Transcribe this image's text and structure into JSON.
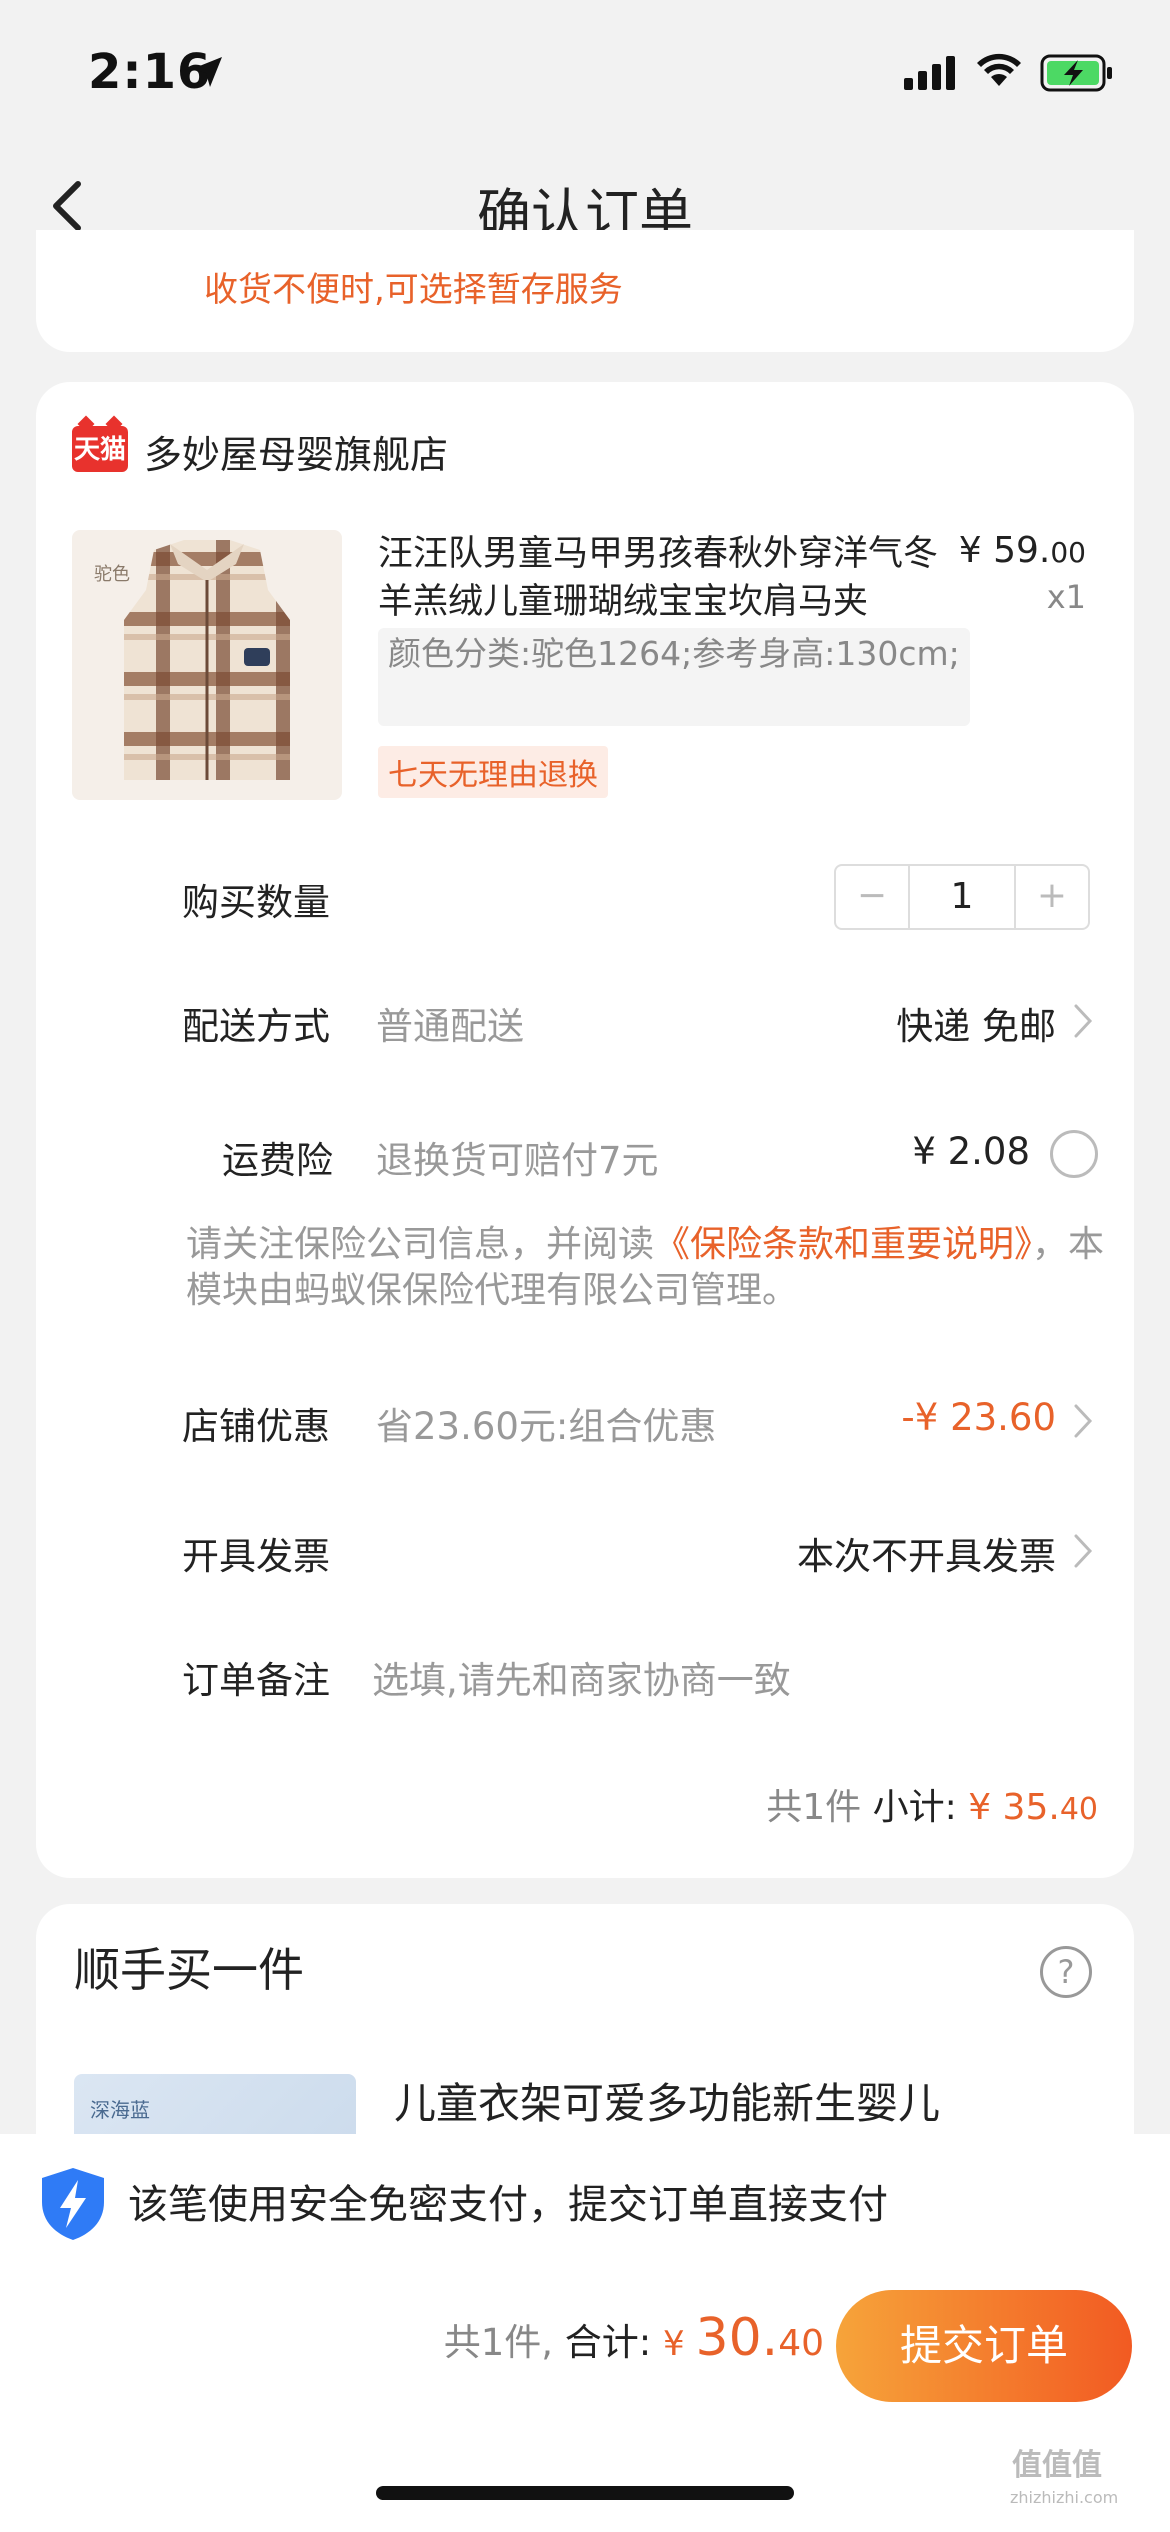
{
  "status_bar": {
    "time": "2:16"
  },
  "nav": {
    "title": "确认订单"
  },
  "temp_service": {
    "text": "收货不便时,可选择暂存服务"
  },
  "shop": {
    "badge": "天猫",
    "name": "多妙屋母婴旗舰店"
  },
  "product": {
    "img_label": "驼色",
    "title": "汪汪队男童马甲男孩春秋外穿洋气冬羊羔绒儿童珊瑚绒宝宝坎肩马夹",
    "price_int": "¥ 59.",
    "price_dec": "00",
    "qty": "x1",
    "sku": "颜色分类:驼色1264;参考身高:130cm;",
    "return_tag": "七天无理由退换"
  },
  "quantity": {
    "label": "购买数量",
    "minus": "−",
    "value": "1",
    "plus": "+"
  },
  "delivery": {
    "label": "配送方式",
    "method": "普通配送",
    "value": "快递 免邮"
  },
  "insurance": {
    "label": "运费险",
    "desc": "退换货可赔付7元",
    "price": "¥ 2.08"
  },
  "notice": {
    "prefix": "请关注保险公司信息，并阅读",
    "link": "《保险条款和重要说明》",
    "suffix": "，本模块由蚂蚁保保险代理有限公司管理。"
  },
  "discount": {
    "label": "店铺优惠",
    "desc": "省23.60元:组合优惠",
    "value": "-¥ 23.60"
  },
  "invoice": {
    "label": "开具发票",
    "value": "本次不开具发票"
  },
  "remark": {
    "label": "订单备注",
    "placeholder": "选填,请先和商家协商一致"
  },
  "subtotal": {
    "count": "共1件",
    "label": "小计:",
    "money_int": "¥ 35.",
    "money_dec": "40"
  },
  "addon": {
    "title": "顺手买一件",
    "help": "?",
    "img_label": "深海蓝",
    "name": "儿童衣架可爱多功能新生婴儿"
  },
  "bottom": {
    "secure": "该笔使用安全免密支付，提交订单直接支付",
    "count": "共1件,",
    "total_label": "合计:",
    "currency": "¥",
    "total_int": "30.",
    "total_dec": "40",
    "submit": "提交订单"
  },
  "watermark": {
    "text": "值值值",
    "sub": "zhizhizhi.com"
  },
  "colors": {
    "accent": "#e8622a",
    "tmall": "#e8322d",
    "submit_start": "#f6a43a",
    "submit_end": "#f25a22"
  }
}
